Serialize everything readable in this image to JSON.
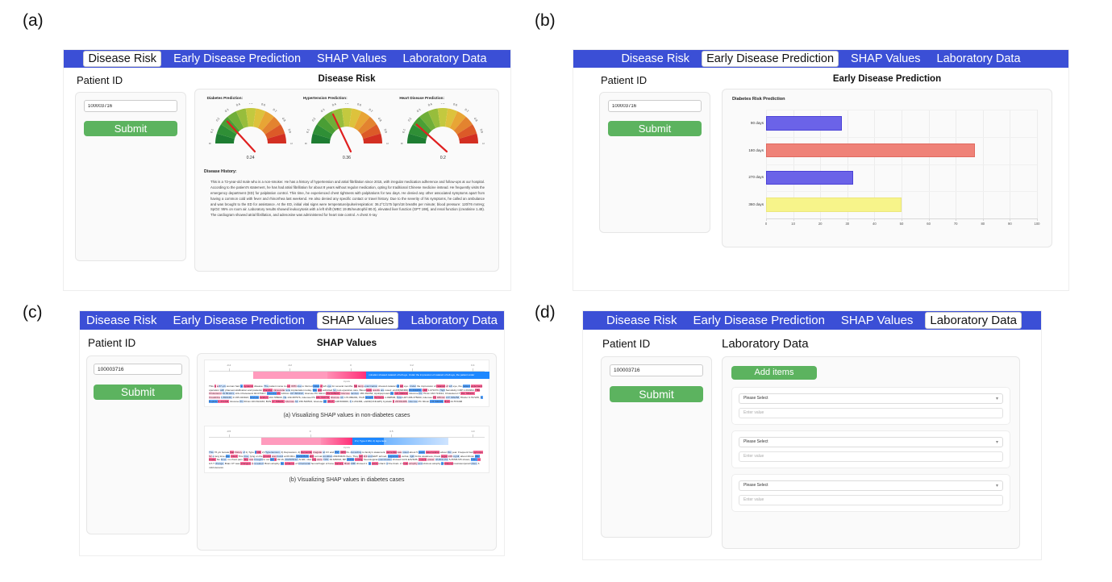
{
  "panels": [
    {
      "label": "(a)"
    },
    {
      "label": "(b)"
    },
    {
      "label": "(c)"
    },
    {
      "label": "(d)"
    }
  ],
  "nav": {
    "items": [
      {
        "label": "Disease Risk"
      },
      {
        "label": "Early Disease Prediction"
      },
      {
        "label": "SHAP Values"
      },
      {
        "label": "Laboratory Data"
      }
    ]
  },
  "sidebar": {
    "title": "Patient ID",
    "patient_id": "100003716",
    "patient_id_placeholder": "Patient ID",
    "submit_label": "Submit"
  },
  "panel_a": {
    "active_tab": "Disease Risk",
    "heading": "Disease Risk",
    "gauges": [
      {
        "title": "Diabetes Prediction:",
        "value": "0.24",
        "value_num": 0.24
      },
      {
        "title": "Hypertension Prediction:",
        "value": "0.36",
        "value_num": 0.36
      },
      {
        "title": "Heart Disease Prediction:",
        "value": "0.2",
        "value_num": 0.2
      }
    ],
    "gauge_ticks": [
      "0",
      "0.1",
      "0.2",
      "0.3",
      "0.4",
      "0.5",
      "0.6",
      "0.7",
      "0.8",
      "0.9",
      "1"
    ],
    "history_title": "Disease History:",
    "history_text": "This is a 72-year-old male who is a non-smoker. He has a history of hypertension and atrial fibrillation since 2015, with irregular medication adherence and follow-ups at our hospital. According to the patient's statement, he has had atrial fibrillation for about 8 years without regular medication, opting for traditional Chinese medicine instead. He frequently visits the emergency department (ED) for palpitation control. This time, he experienced chest tightness with palpitations for two days. He denied any other associated symptoms apart from having a common cold with fever and rhinorrhea last weekend. He also denied any specific contact or travel history. Due to the severity of his symptoms, he called an ambulance and was brought to the ED for assistance. At the ED, initial vital signs were temperature/pulse/respiration: 36.2°C/175 bpm/18 breaths per minute; blood pressure: 120/76 mmHg; SpO2: 95% on room air. Laboratory results showed leukocytosis with a left shift (WBC 19.85/neutrophil 80.0), elevated liver function (GPT 198), and renal function (creatinine 1.48). The cardiogram showed atrial fibrillation, and adenosine was administered for heart rate control. A chest X-ray"
  },
  "panel_b": {
    "active_tab": "Early Disease Prediction",
    "heading": "Early Disease Prediction",
    "chart_data": {
      "type": "bar",
      "orientation": "horizontal",
      "title": "Diabetes Risk Prediction",
      "categories": [
        "90 days",
        "180 days",
        "270 days",
        "360 days"
      ],
      "values": [
        28,
        77,
        32,
        50
      ],
      "colors": [
        "#6b63e8",
        "#ef8278",
        "#6b63e8",
        "#f7f48a"
      ],
      "xlabel": "",
      "ylabel": "",
      "xlim": [
        0,
        100
      ],
      "xticks": [
        "0",
        "10",
        "20",
        "30",
        "40",
        "50",
        "60",
        "70",
        "80",
        "90",
        "100"
      ],
      "grid": true,
      "legend": "none"
    }
  },
  "panel_c": {
    "active_tab": "SHAP Values",
    "heading": "SHAP Values",
    "plots": [
      {
        "caption": "(a) Visualizing SHAP values in non-diabetes cases",
        "inputs_label": "inputs",
        "axis_ticks": [
          "-0.4",
          "-0.2",
          "0",
          "0.2",
          "0.4"
        ],
        "bar_label": "mination showed cataract of left eye. Under the impression of cataract of left eye, the patient under",
        "text": "This is a 67-y/o woman had no systemic disease. The patient came to our OPD due to blurred vision of left eye for several months. Slit lamp examination showed cataract of left eye. Under the impression of cataract of left eye, the patient underwent operation with phacoemulsification and posterior chamber intraocular lens implantation today. She was admitted for post-operative care. Blood tests results are noted: eGFR(MDRD) 83.699259, CRP 1.071673, High Sensitivity CRP 1.094994, HBL Cholesterol 49.561101, LDL-Cholesterol 94.073417, Glucose PC 120min 167.883193, Glucose PC 90min 152.605000, Glucose random 165.332354, Apolipoprotein A1 122.084940, Glucose PC 75min 163.721612, Cholesterol-T 161.788104, Creatinine 1.896438, D 155.023923, Glucose random 163.785000, Na 139.387576, Glucose PC 181.723776, Glucose AC 176.880281, HGH Growth Hormone 1.098538, Total LDH 286.375000, Glucose PC 180min 137.309258, HbA1c 6.797235, C-Peptide 0.472333, Glucose PC 60min 163.814433, BUN 17.788231, Glucose AC 156.520533, Glucose AC (HGT) 148.500000, K 4.231384, eGFR(CKD-EPI) Cystatin C 28.591486, Glucose PC 30min 178.500000, BUN 44.573438"
      },
      {
        "caption": "(b) Visualizing SHAP values in diabetes cases",
        "inputs_label": "inputs",
        "axis_ticks": [
          "-0.5",
          "0",
          "0.5",
          "1.0"
        ],
        "bar_label": "# U, Type 2 DM, 2) Hypertension, 3) Depression, 4) De",
        "text": "This 76 y/o female had history of 1) Type 2 DM, 2) Hypertension, 3) Depression, 4) Dementia, irregular at CV and PSY OPD f/u. According to family's statement, dementia was noted about 5 years, deterioration about this year. Frequent had syncope for a long time also noted. This time, lying on the ground was found at 06:00m, 2023/05/11 and normal condition 2023/04/01 6am. They call 119 and EMT arrived, response to verbal, right limbs weakness, blood sugar 228 mg/dl, about 20min after intake. No fever, no chest pain. She was brought to our ER at 09:16, 2023/05/12. At ER, vital sing were TPR: 36.6/68/16, BP 153/60 mmHg, Neurological examination showed GCS E4V4M6, muscle power: RUR/LU/LL 5-/5/5/5-5/5 shown, HAN, no GT-T change. Brain CT was arranged, it revealed: Brain atrophy. No evidence of intracranial hemorrhagic of bone fracture. Brain MRI showed 1. no acute infarct of the brain. 2. brain atrophy and obvious atrophy of bilateral mesiotemporal lobes. 3. mild stenosis"
      }
    ]
  },
  "panel_d": {
    "active_tab": "Laboratory Data",
    "heading": "Laboratory Data",
    "add_items_label": "Add items",
    "rows": [
      {
        "select_value": "Please Select",
        "input_placeholder": "Enter value"
      },
      {
        "select_value": "Please Select",
        "input_placeholder": "Enter value"
      },
      {
        "select_value": "Please Select",
        "input_placeholder": "Enter value"
      }
    ]
  },
  "colors": {
    "navbar": "#3b4fd6",
    "submit": "#5cb35f",
    "bar_purple": "#6b63e8",
    "bar_red": "#ef8278",
    "bar_yellow": "#f7f48a"
  }
}
